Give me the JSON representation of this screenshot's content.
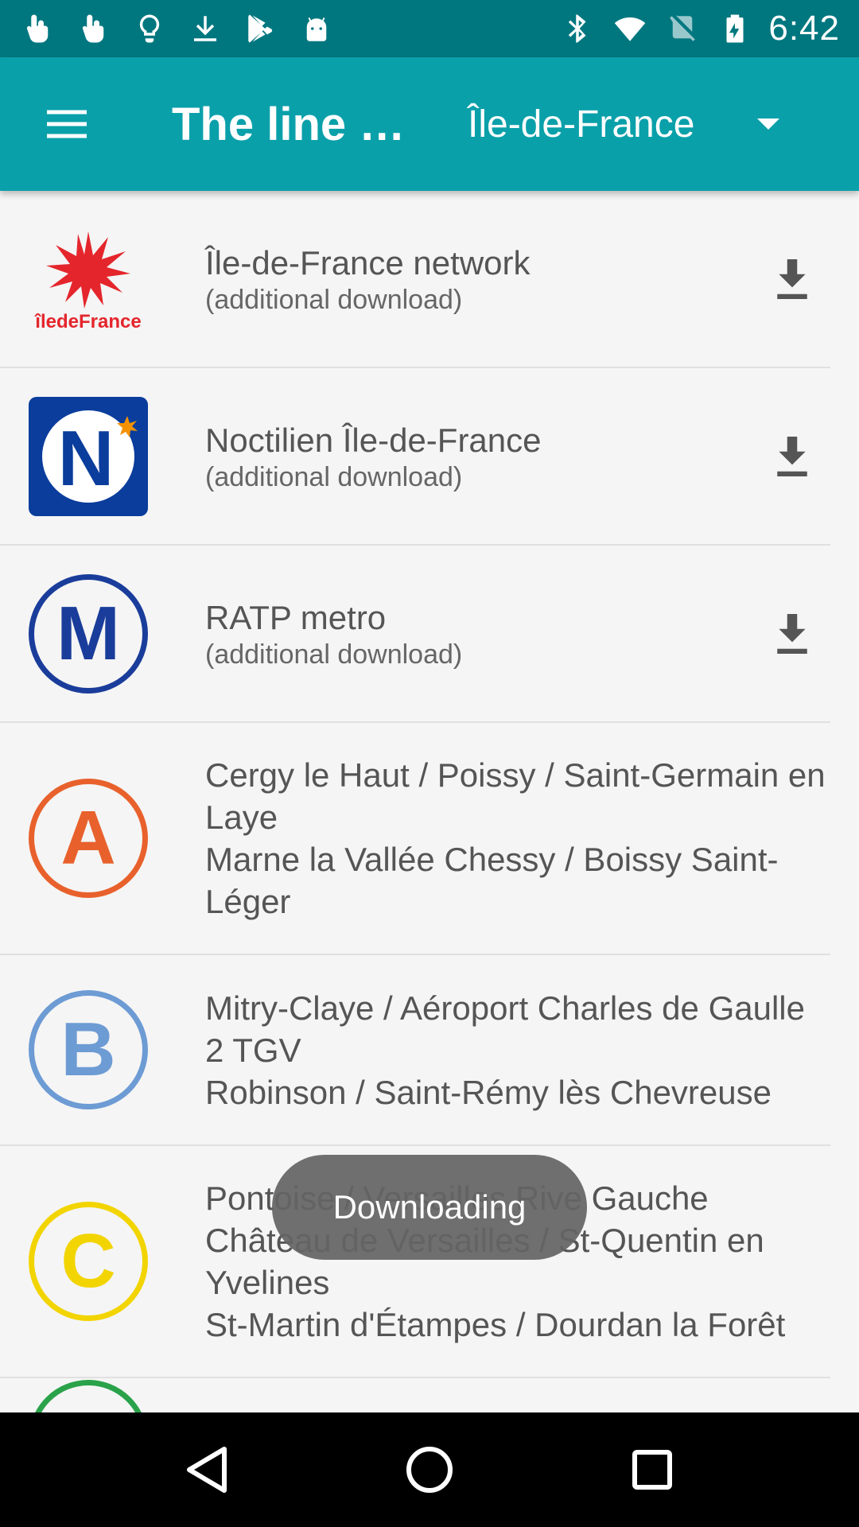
{
  "status_bar": {
    "time": "6:42",
    "left_icons": [
      "touch-icon",
      "touch-icon",
      "lightbulb-icon",
      "download-icon",
      "play-store-icon",
      "android-icon"
    ],
    "right_icons": [
      "bluetooth-icon",
      "wifi-icon",
      "no-sim-icon",
      "battery-charging-icon"
    ]
  },
  "app_bar": {
    "title": "The line maps",
    "region": "Île-de-France"
  },
  "list": [
    {
      "title": "Île-de-France network",
      "subtitle": "(additional download)",
      "logo": "iledefrance-logo",
      "logo_text": "îledeFrance"
    },
    {
      "title": "Noctilien Île-de-France",
      "subtitle": "(additional download)",
      "logo": "noctilien-logo",
      "logo_text": "N"
    },
    {
      "title": "RATP metro",
      "subtitle": "(additional download)",
      "logo": "metro-logo",
      "logo_text": "M"
    },
    {
      "title": "Cergy le Haut / Poissy / Saint-Germain en Laye",
      "title2": "Marne la Vallée Chessy / Boissy Saint-Léger",
      "logo": "rer-a-logo",
      "logo_text": "A",
      "color": "#e8612c"
    },
    {
      "title": "Mitry-Claye / Aéroport Charles de Gaulle 2 TGV",
      "title2": "Robinson / Saint-Rémy lès Chevreuse",
      "logo": "rer-b-logo",
      "logo_text": "B",
      "color": "#6d9bd4"
    },
    {
      "title": "Pontoise / Versailles Rive Gauche",
      "title2": "Château de Versailles / St-Quentin en Yvelines",
      "title3": "St-Martin d'Étampes / Dourdan la Forêt",
      "logo": "rer-c-logo",
      "logo_text": "C",
      "color": "#f2d400"
    }
  ],
  "toast": {
    "text": "Downloading"
  },
  "colors": {
    "status_bar": "#00777f",
    "app_bar": "#0aa0aa",
    "metro_blue": "#1a3d9b",
    "rer_d": "#2aa24a"
  }
}
